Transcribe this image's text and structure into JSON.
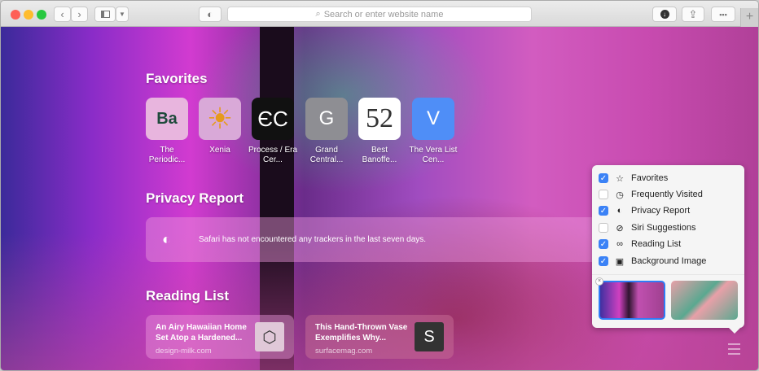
{
  "toolbar": {
    "search_placeholder": "Search or enter website name",
    "colors": {
      "close": "#fe5f57",
      "minimize": "#febc2e",
      "zoom": "#28c840"
    }
  },
  "favorites": {
    "title": "Favorites",
    "items": [
      {
        "glyph": "Ba",
        "label": "The Periodic..."
      },
      {
        "glyph": "☀",
        "label": "Xenia"
      },
      {
        "glyph": "ЄC",
        "label": "Process / Era Cer..."
      },
      {
        "glyph": "G",
        "label": "Grand Central..."
      },
      {
        "glyph": "52",
        "label": "Best Banoffe..."
      },
      {
        "glyph": "V",
        "label": "The Vera List Cen..."
      }
    ]
  },
  "privacy": {
    "title": "Privacy Report",
    "message": "Safari has not encountered any trackers in the last seven days."
  },
  "reading_list": {
    "title": "Reading List",
    "items": [
      {
        "title": "An Airy Hawaiian Home Set Atop a Hardened...",
        "domain": "design-milk.com",
        "thumb": "⬡"
      },
      {
        "title": "This Hand-Thrown Vase Exemplifies Why...",
        "domain": "surfacemag.com",
        "thumb": "S"
      }
    ]
  },
  "customize": {
    "options": [
      {
        "label": "Favorites",
        "icon": "☆",
        "checked": true
      },
      {
        "label": "Frequently Visited",
        "icon": "◷",
        "checked": false
      },
      {
        "label": "Privacy Report",
        "icon": "◐",
        "checked": true
      },
      {
        "label": "Siri Suggestions",
        "icon": "⊘",
        "checked": false
      },
      {
        "label": "Reading List",
        "icon": "∞",
        "checked": true
      },
      {
        "label": "Background Image",
        "icon": "▣",
        "checked": true
      }
    ]
  }
}
